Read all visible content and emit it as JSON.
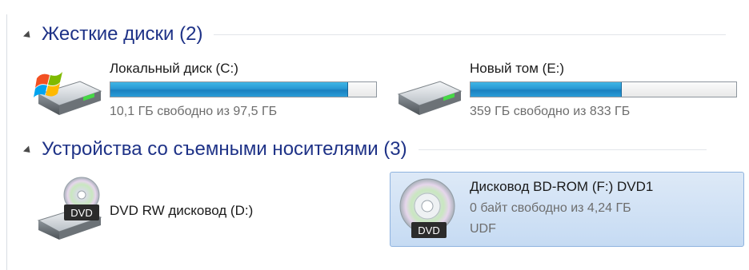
{
  "groups": {
    "hard_disks": {
      "title": "Жесткие диски (2)",
      "drives": [
        {
          "name": "Локальный диск (C:)",
          "free_text": "10,1 ГБ свободно из 97,5 ГБ",
          "used_fraction": 0.896,
          "icon": "windows-drive-icon"
        },
        {
          "name": "Новый том (E:)",
          "free_text": "359 ГБ свободно из 833 ГБ",
          "used_fraction": 0.569,
          "icon": "hard-drive-icon"
        }
      ]
    },
    "removable": {
      "title": "Устройства со съемными носителями (3)",
      "devices": [
        {
          "name": "DVD RW дисковод (D:)",
          "icon": "dvd-drive-icon",
          "badge": "DVD"
        },
        {
          "name": "Дисковод BD-ROM (F:) DVD1",
          "free_text": "0 байт свободно из 4,24 ГБ",
          "filesystem": "UDF",
          "icon": "dvd-disc-icon",
          "badge": "DVD",
          "selected": true
        }
      ]
    }
  },
  "colors": {
    "group_title": "#1e3287",
    "bar_fill": "#2898d3",
    "selection": "#cfe0f5"
  }
}
